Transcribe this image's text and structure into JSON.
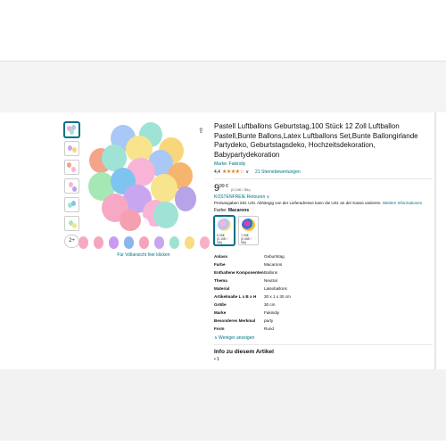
{
  "product": {
    "title": "Pastell Luftballons Geburtstag,100 Stück 12 Zoll Luftballon Pastell,Bunte Ballons,Latex Luftballons Set,Bunte Ballongirlande Partydeko, Geburtstagsdeko, Hochzeitsdekoration, Babypartydekoration",
    "brand": "Marke: Fakindiy",
    "rating_value": "4,4",
    "stars": "★★★★☆",
    "rating_count": "21 Sternebewertungen",
    "price_whole": "9",
    "price_fraction": "99 €",
    "price_unit": "(0,10€ / Stk)",
    "returns": "KOSTENFREIE Retouren ∨",
    "price_note": "Preisangaben inkl. USt. Abhängig von der Lieferadresse kann die USt. an der Kasse variieren.",
    "price_note_link": "Weitere Informationen",
    "color_label": "Farbe:",
    "color_value": "Macarons",
    "variants": [
      {
        "price": "9,99€",
        "unit": "(0,10€ / Stk)"
      },
      {
        "price": "7,99€",
        "unit": "(0,08€ / Stk)"
      }
    ],
    "view_hint": "Für Vollansicht hier klicken",
    "thumb_more": "2+",
    "share_icon": "share-icon"
  },
  "specs": [
    {
      "k": "Anlass",
      "v": "Geburtstag"
    },
    {
      "k": "Farbe",
      "v": "Macarons"
    },
    {
      "k": "Enthaltene Komponenten",
      "v": "Ballons"
    },
    {
      "k": "Thema",
      "v": "Neutral"
    },
    {
      "k": "Material",
      "v": "Latexballons"
    },
    {
      "k": "Artikelmaße L x B x H",
      "v": "30 x 1 x 30 cm"
    },
    {
      "k": "Größe",
      "v": "30 cm"
    },
    {
      "k": "Marke",
      "v": "Fakindiy"
    },
    {
      "k": "Besonderes Merkmal",
      "v": "party"
    },
    {
      "k": "Form",
      "v": "Rund"
    }
  ],
  "less_link": "∧ Weniger anzeigen",
  "info_heading": "Info zu diesem Artikel",
  "info_items": [
    "1"
  ],
  "colors": {
    "link": "#007185",
    "star": "#de7921",
    "balloons": [
      "#f7a8c4",
      "#c9a7f0",
      "#a9c8f5",
      "#f8d77c",
      "#9fe3d6",
      "#f4a48a",
      "#f9b3d6",
      "#b6a3e8",
      "#7fc4f0",
      "#f8e48c",
      "#a6e8b5",
      "#f5b56e"
    ],
    "swatches": [
      "#f6a8c6",
      "#f5a5bf",
      "#c89af0",
      "#8cb5f0",
      "#f7a3b9",
      "#c7a6ef",
      "#9ee2d0",
      "#f8db82",
      "#f6b1c8"
    ]
  }
}
